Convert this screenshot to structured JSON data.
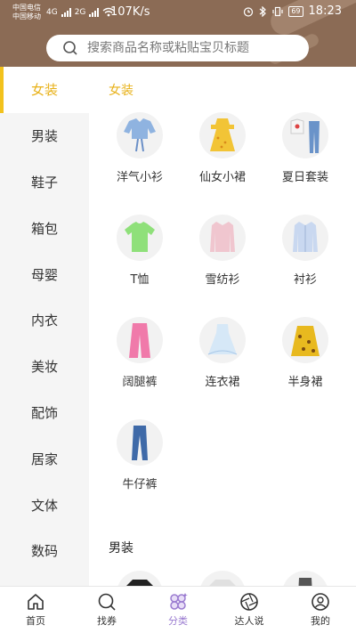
{
  "status_bar": {
    "carrier1": "中国电信",
    "carrier2": "中国移动",
    "net1": "4G",
    "net2": "2G",
    "speed": "107K/s",
    "battery": "69",
    "time": "18:23"
  },
  "search": {
    "placeholder": "搜索商品名称或粘贴宝贝标题"
  },
  "sidebar": {
    "items": [
      {
        "label": "女装",
        "active": true
      },
      {
        "label": "男装"
      },
      {
        "label": "鞋子"
      },
      {
        "label": "箱包"
      },
      {
        "label": "母婴"
      },
      {
        "label": "内衣"
      },
      {
        "label": "美妆"
      },
      {
        "label": "配饰"
      },
      {
        "label": "居家"
      },
      {
        "label": "文体"
      },
      {
        "label": "数码"
      }
    ]
  },
  "main": {
    "sections": [
      {
        "title": "女装",
        "items": [
          {
            "label": "洋气小衫",
            "icon": "blouse-icon",
            "color": "#8fb3e0"
          },
          {
            "label": "仙女小裙",
            "icon": "dress-icon",
            "color": "#f2c436"
          },
          {
            "label": "夏日套装",
            "icon": "outfit-set-icon",
            "color": "#6a93c9"
          },
          {
            "label": "T恤",
            "icon": "tshirt-icon",
            "color": "#8fe07a"
          },
          {
            "label": "雪纺衫",
            "icon": "chiffon-shirt-icon",
            "color": "#f0c6cf"
          },
          {
            "label": "衬衫",
            "icon": "shirt-icon",
            "color": "#c9d8f0"
          },
          {
            "label": "阔腿裤",
            "icon": "wide-pants-icon",
            "color": "#f07aaa"
          },
          {
            "label": "连衣裙",
            "icon": "white-dress-icon",
            "color": "#d6e8f7"
          },
          {
            "label": "半身裙",
            "icon": "skirt-icon",
            "color": "#e8b91f"
          },
          {
            "label": "牛仔裤",
            "icon": "jeans-icon",
            "color": "#3f6aa8"
          }
        ]
      },
      {
        "title": "男装",
        "items": [
          {
            "icon": "men-top-icon",
            "color": "#222222"
          },
          {
            "icon": "men-shirt-icon",
            "color": "#e0e0e0"
          },
          {
            "icon": "men-pants-icon",
            "color": "#555555"
          }
        ]
      }
    ]
  },
  "bottom_nav": [
    {
      "label": "首页",
      "icon": "home-icon"
    },
    {
      "label": "找券",
      "icon": "search-coupon-icon"
    },
    {
      "label": "分类",
      "icon": "category-icon",
      "active": true
    },
    {
      "label": "达人说",
      "icon": "aperture-icon"
    },
    {
      "label": "我的",
      "icon": "user-icon"
    }
  ],
  "colors": {
    "header_bg": "#8b6b55",
    "accent_yellow": "#e8b21a",
    "active_nav": "#9a7bd0"
  }
}
